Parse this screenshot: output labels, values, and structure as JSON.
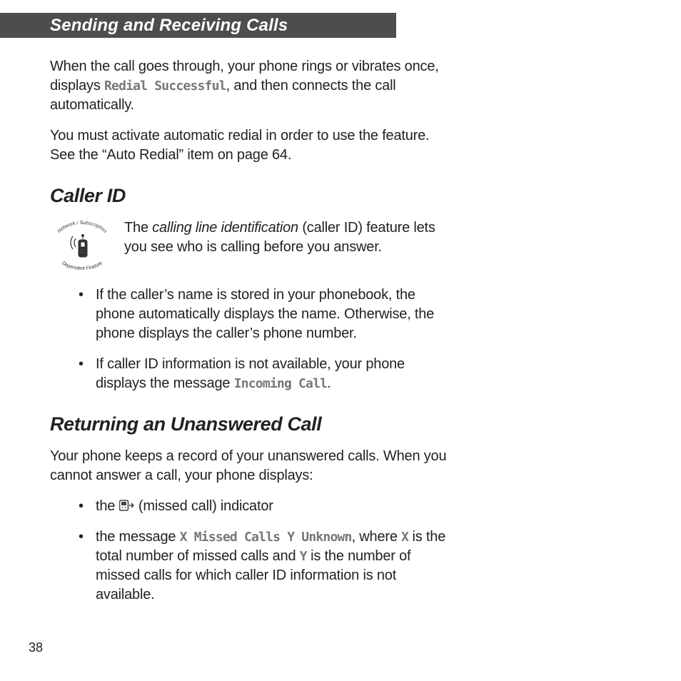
{
  "header": {
    "title": "Sending and Receiving Calls"
  },
  "intro": {
    "p1a": "When the call goes through, your phone rings or vibrates once, displays ",
    "redial_successful": "Redial Successful",
    "p1b": ", and then connects the call automatically.",
    "p2": "You must activate automatic redial in order to use the feature. See the “Auto Redial” item on page 64."
  },
  "caller_id": {
    "heading": "Caller ID",
    "icon_top": "Network / Subscription",
    "icon_bottom": "Dependent Feature",
    "lead_a": "The ",
    "lead_em": "calling line identification",
    "lead_b": " (caller ID) feature lets you see who is calling before you answer.",
    "b1": "If the caller’s name is stored in your phonebook, the phone automatically displays the name. Otherwise, the phone displays the caller’s phone number.",
    "b2a": "If caller ID information is not available, your phone displays the message ",
    "incoming_call": "Incoming Call",
    "b2b": "."
  },
  "returning": {
    "heading": "Returning an Unanswered Call",
    "p1": "Your phone keeps a record of your unanswered calls. When you cannot answer a call, your phone displays:",
    "b1a": "the ",
    "b1b": " (missed call) indicator",
    "b2a": "the message ",
    "msg": "X Missed Calls Y Unknown",
    "b2b": ", where ",
    "x": "X",
    "b2c": " is the total number of missed calls and ",
    "y": "Y",
    "b2d": " is the number of missed calls for which caller ID information is not available."
  },
  "page_number": "38"
}
